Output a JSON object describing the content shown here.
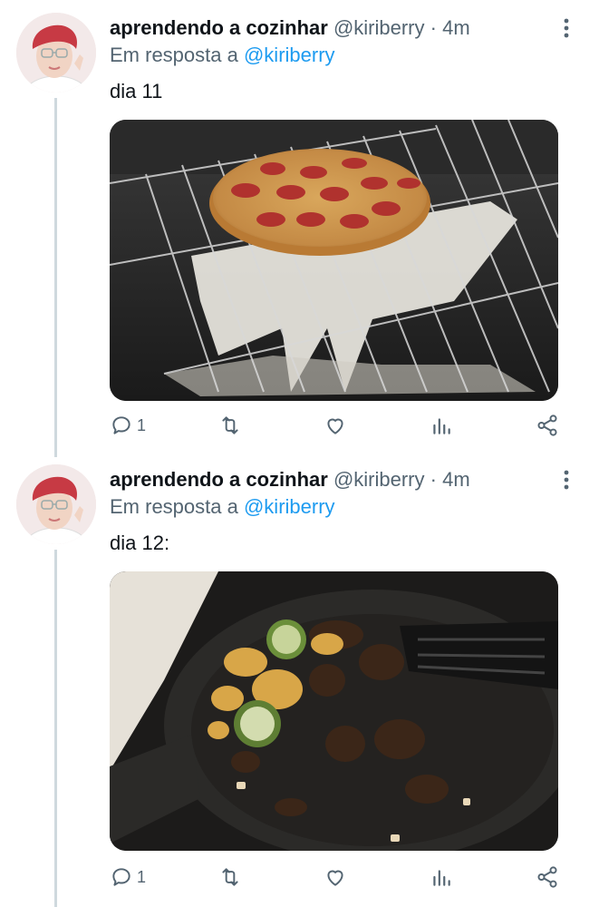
{
  "tweets": [
    {
      "name": "aprendendo a cozinhar",
      "handle": "@kiriberry",
      "dot": "·",
      "time": "4m",
      "reply_prefix": "Em resposta a",
      "reply_to": "@kiriberry",
      "text": "dia 11",
      "media_subject": "pizza melted onto oven rack",
      "replies": "1",
      "icons": [
        "reply-icon",
        "retweet-icon",
        "like-icon",
        "views-icon",
        "share-icon"
      ]
    },
    {
      "name": "aprendendo a cozinhar",
      "handle": "@kiriberry",
      "dot": "·",
      "time": "4m",
      "reply_prefix": "Em resposta a",
      "reply_to": "@kiriberry",
      "text": "dia 12:",
      "media_subject": "burnt vegetables in cast iron skillet",
      "replies": "1",
      "icons": [
        "reply-icon",
        "retweet-icon",
        "like-icon",
        "views-icon",
        "share-icon"
      ]
    }
  ],
  "colors": {
    "text": "#0f1419",
    "secondary": "#536471",
    "link": "#1d9bf0",
    "thread_line": "#cfd9de"
  }
}
